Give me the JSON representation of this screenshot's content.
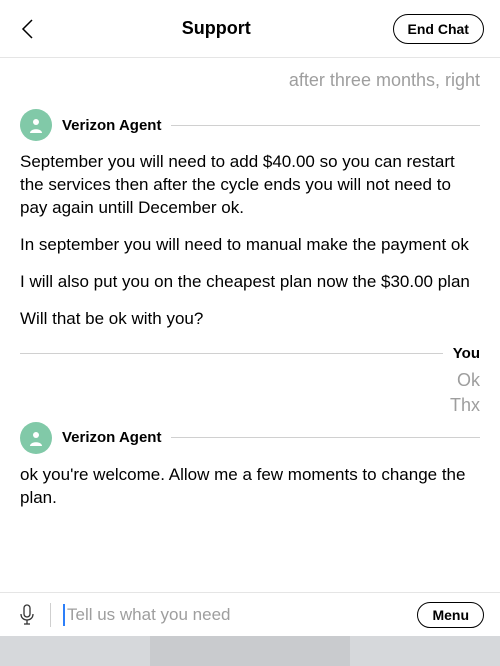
{
  "header": {
    "title": "Support",
    "end_chat": "End Chat"
  },
  "prev_trail": "after three months, right",
  "agent_name": "Verizon Agent",
  "agent1_msgs": [
    "September you will need to add $40.00 so you can restart the services then after the cycle ends you will not need to pay again untill December ok.",
    "In september you will need to manual make the payment ok",
    "I will also put you on the cheapest plan now the $30.00 plan",
    "Will that be ok with you?"
  ],
  "you_label": "You",
  "you_msgs": [
    "Ok",
    "Thx"
  ],
  "agent2_msgs": [
    "ok you're welcome. Allow me a few moments to change the plan."
  ],
  "input": {
    "placeholder": "Tell us what you need",
    "menu": "Menu"
  }
}
